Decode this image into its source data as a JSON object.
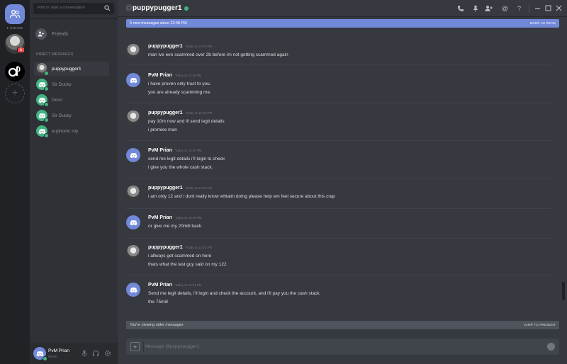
{
  "rail": {
    "home_label": "1 ONLINE",
    "badge_count": "5"
  },
  "sidebar": {
    "search_placeholder": "Find or start a conversation",
    "friends_label": "Friends",
    "dm_header": "DIRECT MESSAGES",
    "dms": [
      {
        "name": "puppypugger1",
        "avatar": "photo",
        "active": true
      },
      {
        "name": "Sir Ducky",
        "avatar": "discord",
        "active": false
      },
      {
        "name": "Doco",
        "avatar": "discord",
        "active": false
      },
      {
        "name": "Sir Ducky",
        "avatar": "discord",
        "active": false
      },
      {
        "name": "euphonic roy",
        "avatar": "discord",
        "active": false
      }
    ]
  },
  "user_panel": {
    "name": "PvM Prian",
    "tag": "#6260"
  },
  "header": {
    "at": "@",
    "channel": "puppypugger1",
    "icons": [
      "phone-icon",
      "pin-icon",
      "add-friend-icon",
      "mention-icon",
      "help-icon",
      "minimize-icon",
      "maximize-icon",
      "close-icon"
    ]
  },
  "new_messages": {
    "text": "5 new messages since 12:48 PM",
    "action": "MARK AS READ"
  },
  "messages": [
    {
      "author": "puppypugger1",
      "avatar": "photo",
      "time": "Today at 12:29 PM",
      "lines": [
        "man ive een scammed over 2b before im not getting scammed again"
      ]
    },
    {
      "author": "PvM Prian",
      "avatar": "bot",
      "time": "Today at 12:29 PM",
      "lines": [
        "i have proven only trust to you.",
        "you are already scamming me."
      ]
    },
    {
      "author": "puppypugger1",
      "avatar": "photo",
      "time": "Today at 12:30 PM",
      "lines": [
        "pay 10m now and ill send legit details",
        "i promise man"
      ]
    },
    {
      "author": "PvM Prian",
      "avatar": "bot",
      "time": "Today at 12:30 PM",
      "lines": [
        "send me legit details i'll login to check",
        "i give you the whole cash stack."
      ]
    },
    {
      "author": "puppypugger1",
      "avatar": "photo",
      "time": "Today at 12:30 PM",
      "lines": [
        "i am only 12 and i dont really know whtaim doing please help em feel secure about this crap"
      ]
    },
    {
      "author": "PvM Prian",
      "avatar": "bot",
      "time": "Today at 12:30 PM",
      "lines": [
        "or give me my 20mill back"
      ]
    },
    {
      "author": "puppypugger1",
      "avatar": "photo",
      "time": "Today at 12:30 PM",
      "lines": [
        "i allways get scammed on here",
        "thats what the last guy said on my 122"
      ]
    },
    {
      "author": "PvM Prian",
      "avatar": "bot",
      "time": "Today at 12:31 PM",
      "lines": [
        "Send me legit details, i'll login and check the account, and i'll pay you the cash stack.",
        "the 75mill"
      ]
    }
  ],
  "older_bar": {
    "text": "You're viewing older messages",
    "action": "JUMP TO PRESENT"
  },
  "composer": {
    "placeholder": "Message @puppypugger1"
  },
  "colors": {
    "accent": "#7289da",
    "online": "#43b581",
    "badge": "#f04747",
    "background": "#36393f",
    "sidebar": "#2f3136"
  }
}
